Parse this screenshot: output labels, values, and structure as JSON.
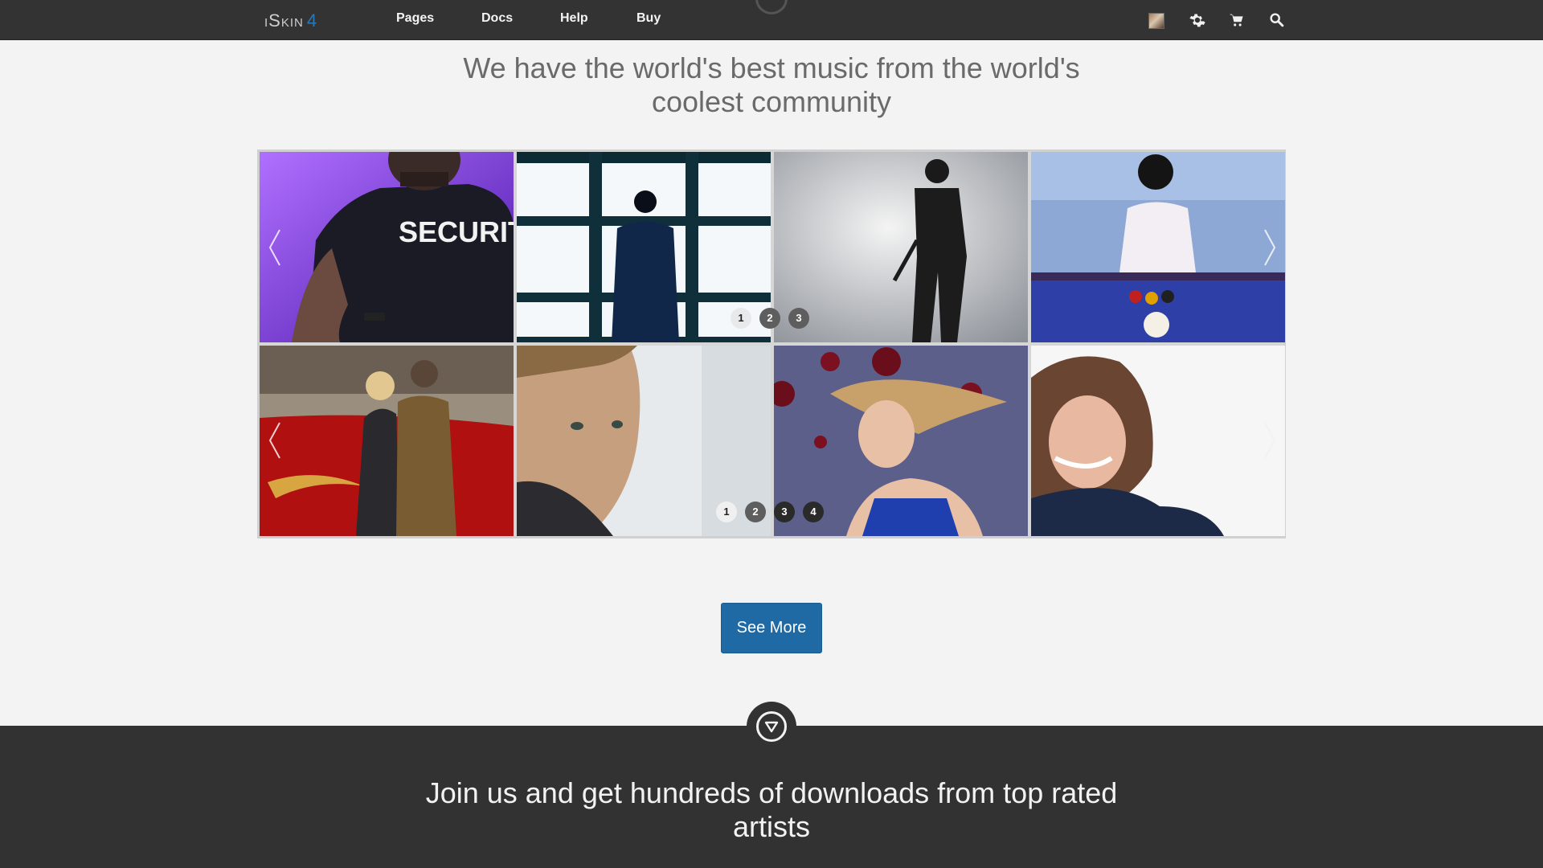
{
  "brand": {
    "logo_text": "iSkin",
    "version": "4"
  },
  "nav": {
    "links": [
      "Pages",
      "Docs",
      "Help",
      "Buy"
    ]
  },
  "headline": "We have the world's best music from the world's coolest community",
  "gallery": {
    "row1": {
      "images": [
        "security-guard-photo",
        "man-at-window-photo",
        "soldier-silhouette-photo",
        "pool-player-photo"
      ],
      "image_text": "SECURITY",
      "pagination": [
        "1",
        "2",
        "3"
      ]
    },
    "row2": {
      "images": [
        "couple-by-car-photo",
        "man-portrait-photo",
        "woman-hair-flowing-photo",
        "smiling-woman-photo"
      ],
      "pagination": [
        "1",
        "2",
        "3",
        "4"
      ]
    }
  },
  "cta": {
    "label": "See More"
  },
  "band": {
    "text": "Join us and get hundreds of downloads from top rated artists"
  },
  "colors": {
    "navbar": "#333333",
    "accent": "#1f6aa5",
    "band": "#323232",
    "page_bg": "#f3f3f3"
  }
}
